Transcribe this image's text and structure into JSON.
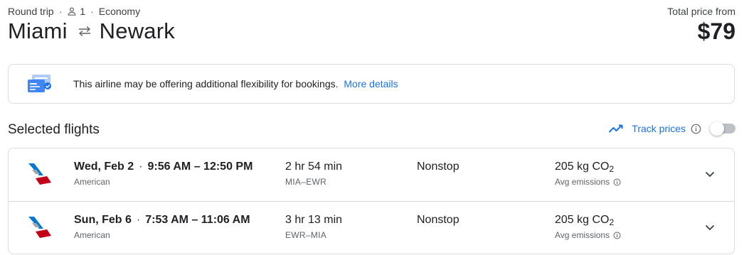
{
  "trip": {
    "type": "Round trip",
    "passengers": "1",
    "cabin": "Economy",
    "origin": "Miami",
    "destination": "Newark"
  },
  "price": {
    "label": "Total price from",
    "amount": "$79"
  },
  "banner": {
    "text": "This airline may be offering additional flexibility for bookings.",
    "link": "More details"
  },
  "selected": {
    "title": "Selected flights",
    "track_label": "Track prices",
    "track_enabled": false
  },
  "flights": [
    {
      "date": "Wed, Feb 2",
      "time": "9:56 AM – 12:50 PM",
      "airline": "American",
      "duration": "2 hr 54 min",
      "airports": "MIA–EWR",
      "stops": "Nonstop",
      "co2_value": "205 kg CO",
      "co2_sub": "2",
      "emissions_label": "Avg emissions"
    },
    {
      "date": "Sun, Feb 6",
      "time": "7:53 AM – 11:06 AM",
      "airline": "American",
      "duration": "3 hr 13 min",
      "airports": "EWR–MIA",
      "stops": "Nonstop",
      "co2_value": "205 kg CO",
      "co2_sub": "2",
      "emissions_label": "Avg emissions"
    }
  ],
  "colors": {
    "accent": "#1a73e8",
    "text": "#202124",
    "muted": "#5f6368",
    "border": "#dadce0",
    "airline_red": "#c30019",
    "airline_blue": "#0078d2"
  },
  "icons": {
    "person": "person-icon",
    "swap": "swap-arrows-icon",
    "banner": "booking-flexibility-illustration",
    "trend": "trend-line-icon",
    "info": "info-icon",
    "chevron": "chevron-down-icon",
    "airline_logo": "american-airlines-logo"
  }
}
